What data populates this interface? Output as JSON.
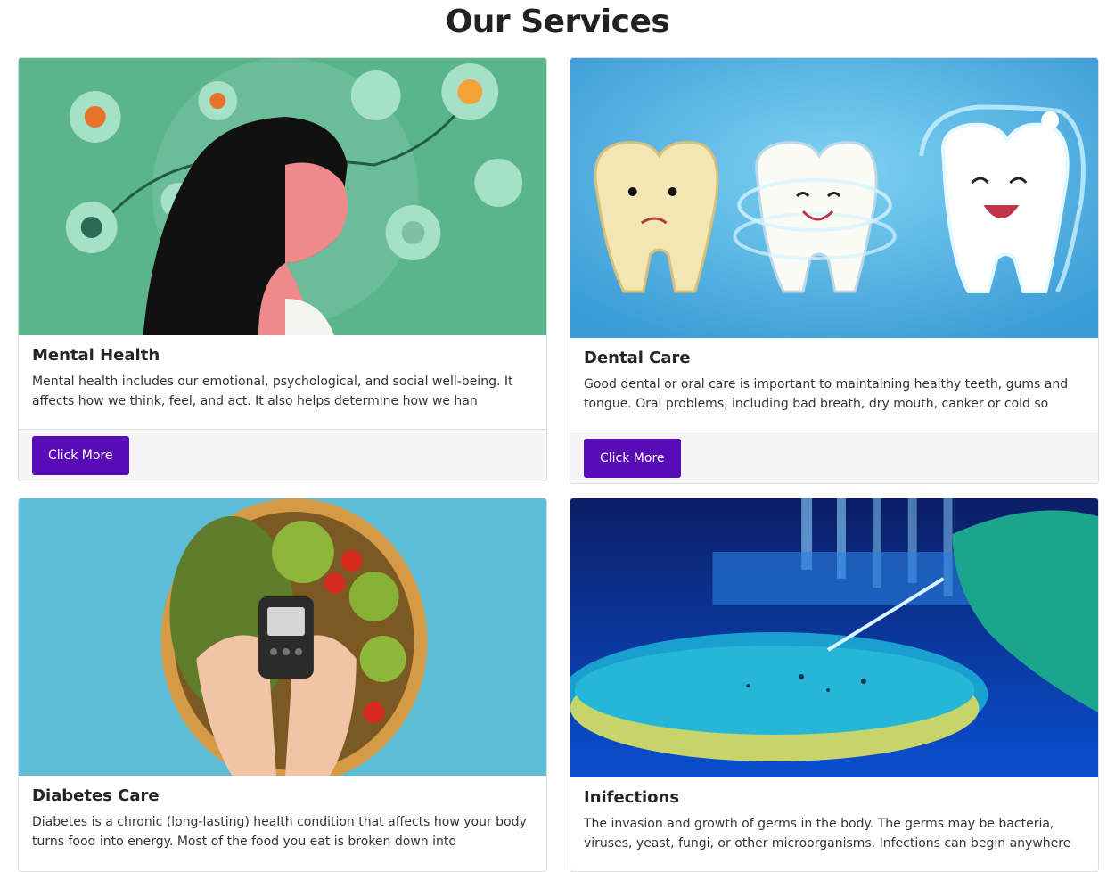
{
  "page": {
    "title": "Our Services"
  },
  "cards": [
    {
      "title": "Mental Health",
      "text": "Mental health includes our emotional, psychological, and social well-being. It affects how we think, feel, and act. It also helps determine how we han",
      "button": "Click More",
      "image_bg": "#5bb58c"
    },
    {
      "title": "Dental Care",
      "text": "Good dental or oral care is important to maintaining healthy teeth, gums and tongue. Oral problems, including bad breath, dry mouth, canker or cold so",
      "button": "Click More",
      "image_bg": "#4fb3df"
    },
    {
      "title": "Diabetes Care",
      "text": "Diabetes is a chronic (long-lasting) health condition that affects how your body turns food into energy. Most of the food you eat is broken down into",
      "image_bg": "#5dbcd6"
    },
    {
      "title": "Inifections",
      "text": "The invasion and growth of germs in the body. The germs may be bacteria, viruses, yeast, fungi, or other microorganisms. Infections can begin anywhere",
      "image_bg": "#0a3ea8"
    }
  ],
  "colors": {
    "button": "#5a0bb8",
    "footer": "#f5f5f5"
  }
}
